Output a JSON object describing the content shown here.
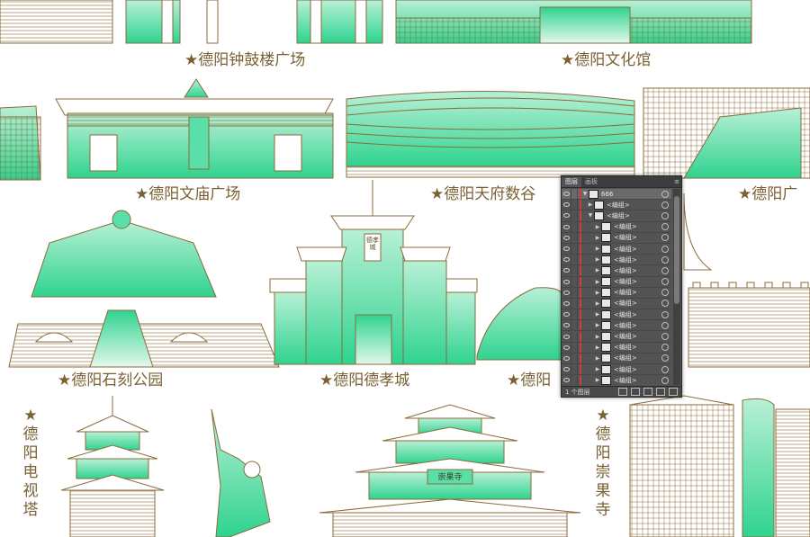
{
  "captions": {
    "zhonggulou": "★德阳钟鼓楼广场",
    "wenhuaguan": "★德阳文化馆",
    "wenmiao": "★德阳文庙广场",
    "tianfu": "★德阳天府数谷",
    "guang": "★德阳广",
    "shike": "★德阳石刻公园",
    "dexiao": "★德阳德孝城",
    "deyang_partial": "★德阳",
    "dianshita": "★德阳电视塔",
    "chongguosi": "★德阳崇果寺"
  },
  "signs": {
    "dexiao_plaque": "德孝城",
    "chongguosi_plaque": "崇果寺"
  },
  "layers_panel": {
    "tabs": [
      "图层",
      "画板"
    ],
    "menu_icon": "panel-menu-icon",
    "top_layer": "666",
    "group_label": "<编组>",
    "group_open_label": "<编组>",
    "item_label": "<编组>",
    "footer_count": "1 个图层",
    "footer_icons": [
      "export-icon",
      "locate-icon",
      "sublayer-icon",
      "new-layer-icon",
      "delete-icon"
    ]
  },
  "colors": {
    "mint": "#2fd38f",
    "mint_light": "#c8f3dc",
    "outline": "#8a6b3a",
    "caption": "#7a6033",
    "panel": "#535353"
  }
}
